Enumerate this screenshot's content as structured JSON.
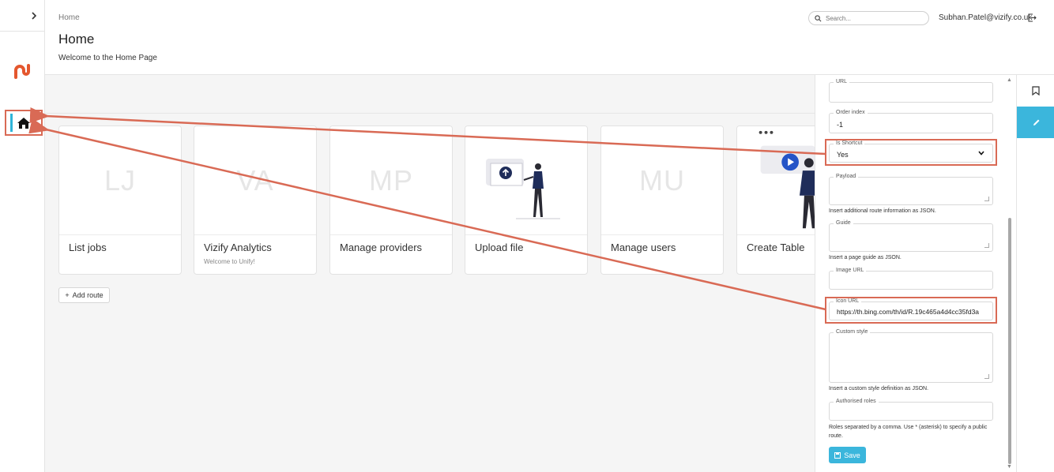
{
  "header": {
    "breadcrumb": "Home",
    "title": "Home",
    "subtitle": "Welcome to the Home Page",
    "search_placeholder": "Search...",
    "user_email": "Subhan.Patel@vizify.co.uk"
  },
  "cards": [
    {
      "initials": "LJ",
      "label": "List jobs",
      "description": ""
    },
    {
      "initials": "VA",
      "label": "Vizify Analytics",
      "description": "Welcome to Unify!"
    },
    {
      "initials": "MP",
      "label": "Manage providers",
      "description": ""
    },
    {
      "initials": "",
      "label": "Upload file",
      "description": ""
    },
    {
      "initials": "MU",
      "label": "Manage users",
      "description": ""
    },
    {
      "initials": "",
      "label": "Create Table",
      "description": ""
    }
  ],
  "add_route_label": "Add route",
  "panel": {
    "url": {
      "label": "URL",
      "value": ""
    },
    "order_index": {
      "label": "Order index",
      "value": "-1"
    },
    "is_shortcut": {
      "label": "Is Shortcut",
      "value": "Yes"
    },
    "payload": {
      "label": "Payload",
      "value": "",
      "hint": "Insert additional route information as JSON."
    },
    "guide": {
      "label": "Guide",
      "value": "",
      "hint": "Insert a page guide as JSON."
    },
    "image_url": {
      "label": "Image URL",
      "value": ""
    },
    "icon_url": {
      "label": "Icon URL",
      "value": "https://th.bing.com/th/id/R.19c465a4d4cc35fd3a"
    },
    "custom_style": {
      "label": "Custom style",
      "value": "",
      "hint": "Insert a custom style definition as JSON."
    },
    "authorised_roles": {
      "label": "Authorised roles",
      "value": "",
      "hint": "Roles separated by a comma. Use * (asterisk) to specify a public route."
    },
    "save_label": "Save"
  },
  "colors": {
    "accent": "#3bb6dc",
    "annotation": "#d96a55",
    "brand": "#e4572e"
  },
  "icons": {
    "rail_toggle": "chevron-right-icon",
    "home": "home-icon",
    "search": "search-icon",
    "logout": "logout-icon",
    "bookmark": "bookmark-icon",
    "edit": "pencil-icon",
    "save": "floppy-icon"
  }
}
